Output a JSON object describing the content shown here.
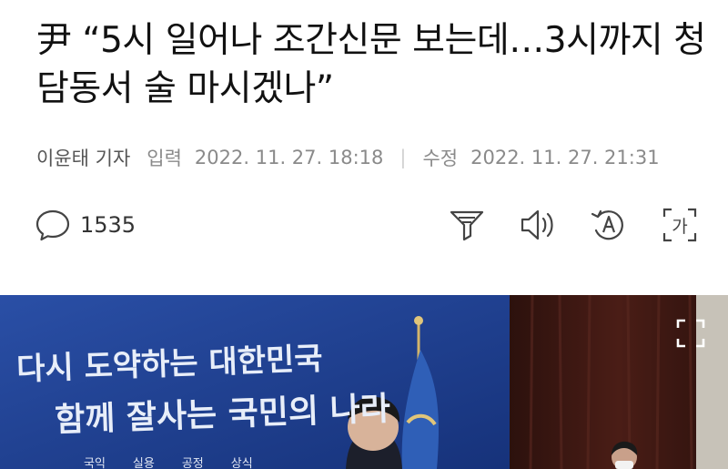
{
  "article": {
    "headline": "尹 “5시 일어나 조간신문 보는데…3시까지 청담동서 술 마시겠나”",
    "reporter": "이윤태 기자",
    "input_label": "입력",
    "input_time": "2022. 11. 27. 18:18",
    "modified_label": "수정",
    "modified_time": "2022. 11. 27. 21:31"
  },
  "toolbar": {
    "comment_count": "1535",
    "icons": [
      "comment-icon",
      "filter-icon",
      "speaker-icon",
      "translate-icon",
      "font-size-icon"
    ],
    "font_size_glyph": "가"
  },
  "photo": {
    "banner_line1": "다시 도약하는 대한민국",
    "banner_line2": "함께 잘사는 국민의 나라",
    "values": [
      "국익",
      "실용",
      "공정",
      "상식"
    ],
    "expand_icon": "expand-icon",
    "colors": {
      "backdrop": "#1b3a86",
      "curtain": "#3a1712",
      "flag": "#2f5fb7"
    }
  }
}
